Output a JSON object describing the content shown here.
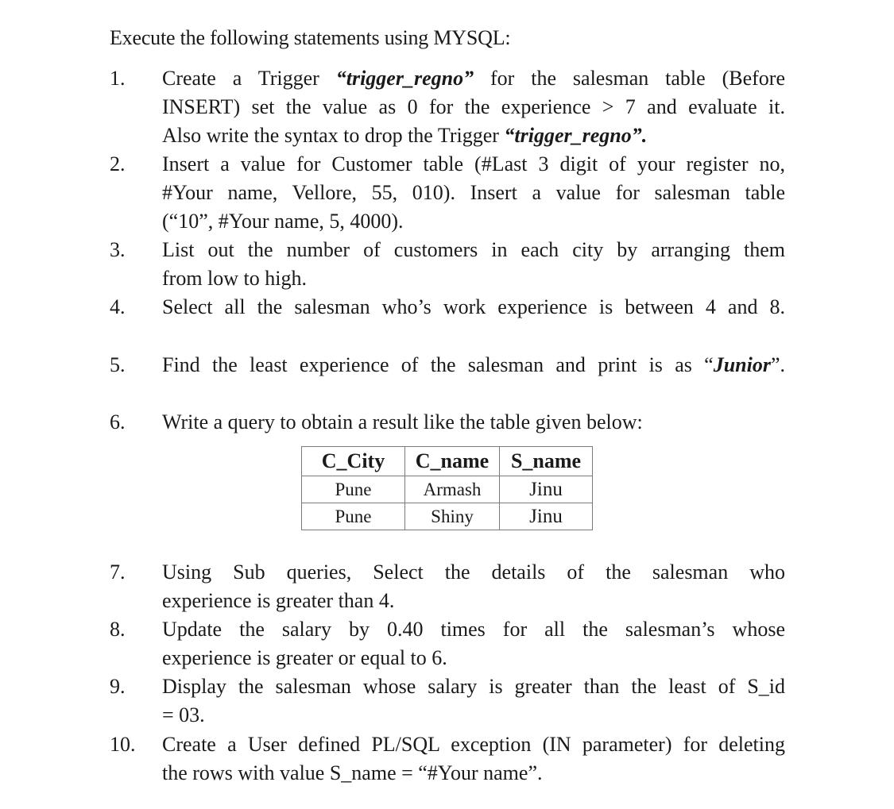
{
  "heading": "Execute the following statements using MYSQL:",
  "questions": [
    {
      "num": "1.",
      "lines": [
        [
          "Create a Trigger ",
          "“trigger_regno”",
          " for the salesman table (Before"
        ],
        [
          "INSERT) set the value as 0 for the experience > 7 and evaluate it."
        ],
        [
          "Also write the syntax to drop the Trigger ",
          "“trigger_regno”."
        ]
      ]
    },
    {
      "num": "2.",
      "lines": [
        "Insert a value for Customer table (#Last 3 digit of your register no,",
        "#Your name, Vellore, 55, 010). Insert a value for salesman table",
        "(“10”, #Your name, 5, 4000)."
      ]
    },
    {
      "num": "3.",
      "lines": [
        "List out the number of customers in each city by arranging them",
        "from low to high."
      ]
    },
    {
      "num": "4.",
      "lines": [
        "Select all the salesman who’s work experience is between 4 and 8."
      ]
    },
    {
      "num": "5.",
      "text_before": "Find the least experience of the salesman and print is as “",
      "emphasis": "Junior",
      "text_after": "”."
    },
    {
      "num": "6.",
      "lines": [
        "Write a query to obtain a result like the table given below:"
      ]
    },
    {
      "num": "7.",
      "lines": [
        "Using Sub queries, Select the details of the salesman who",
        "experience is greater than 4."
      ]
    },
    {
      "num": "8.",
      "lines": [
        "Update the salary by 0.40 times for all the salesman’s whose",
        "experience is greater or equal to 6."
      ]
    },
    {
      "num": "9.",
      "lines": [
        "Display the salesman whose salary is greater than the least of S_id",
        "= 03."
      ]
    },
    {
      "num": "10.",
      "lines": [
        "Create a User defined PL/SQL exception (IN parameter) for deleting",
        "the rows with value S_name = “#Your name”."
      ]
    }
  ],
  "result_table": {
    "headers": [
      "C_City",
      "C_name",
      "S_name"
    ],
    "rows": [
      [
        "Pune",
        "Armash",
        "Jinu"
      ],
      [
        "Pune",
        "Shiny",
        "Jinu"
      ]
    ]
  }
}
